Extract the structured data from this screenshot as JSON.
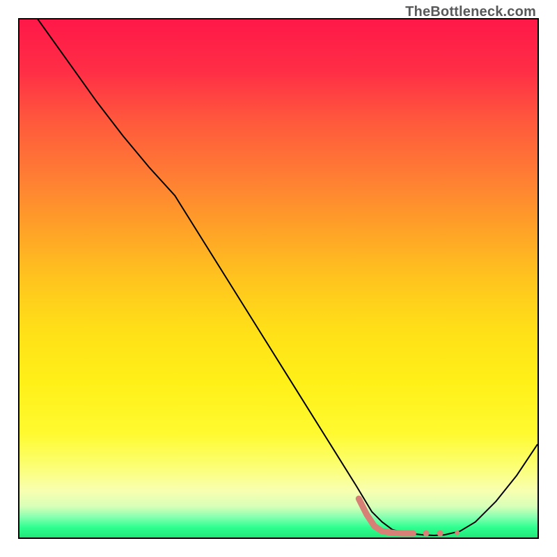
{
  "watermark": "TheBottleneck.com",
  "chart_data": {
    "type": "line",
    "title": "",
    "xlabel": "",
    "ylabel": "",
    "xlim": [
      0,
      100
    ],
    "ylim": [
      0,
      100
    ],
    "grid": false,
    "legend": false,
    "background_gradient": {
      "stops": [
        {
          "pos": 0,
          "color": "#ff1848"
        },
        {
          "pos": 50,
          "color": "#ffc41e"
        },
        {
          "pos": 85,
          "color": "#fcff70"
        },
        {
          "pos": 100,
          "color": "#20e878"
        }
      ]
    },
    "series": [
      {
        "name": "value-curve",
        "stroke": "#000000",
        "stroke_width": 2,
        "x": [
          0,
          5,
          10,
          15,
          20,
          25,
          30,
          35,
          40,
          45,
          50,
          55,
          60,
          65,
          68,
          70,
          72,
          75,
          78,
          80,
          82,
          85,
          88,
          92,
          96,
          100
        ],
        "y": [
          105,
          98,
          91,
          84,
          77.5,
          71.5,
          66,
          58,
          50,
          42,
          34,
          26,
          18,
          10,
          5,
          3,
          1.5,
          0.8,
          0.5,
          0.4,
          0.5,
          1.2,
          3,
          7,
          12,
          18
        ]
      },
      {
        "name": "salmon-marker-segment",
        "stroke": "#d68076",
        "stroke_width": 9,
        "linecap": "round",
        "x": [
          65.5,
          67,
          68.5,
          70,
          72,
          74,
          76
        ],
        "y": [
          7.5,
          4.5,
          2.2,
          1.2,
          0.9,
          0.8,
          0.8
        ]
      },
      {
        "name": "salmon-dot-1",
        "type": "scatter",
        "color": "#d68076",
        "radius": 4.5,
        "x": [
          78.5
        ],
        "y": [
          0.8
        ]
      },
      {
        "name": "salmon-dot-2",
        "type": "scatter",
        "color": "#d68076",
        "radius": 4.5,
        "x": [
          81.2
        ],
        "y": [
          0.8
        ]
      },
      {
        "name": "salmon-dot-3",
        "type": "scatter",
        "color": "#d68076",
        "radius": 3.5,
        "x": [
          84.5
        ],
        "y": [
          0.9
        ]
      }
    ]
  }
}
